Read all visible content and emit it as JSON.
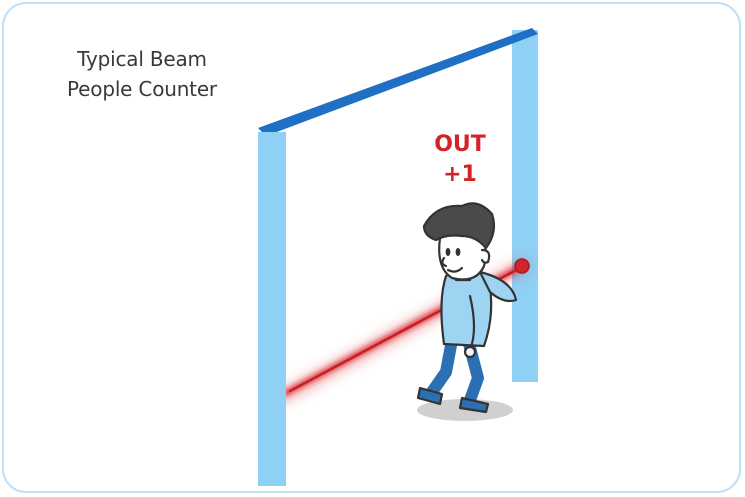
{
  "title": {
    "line1": "Typical Beam",
    "line2": "People Counter"
  },
  "counter": {
    "direction": "OUT",
    "increment": "+1"
  },
  "colors": {
    "frame_border": "#bfe0f7",
    "post_light_blue": "#8fd0f5",
    "header_beam_blue": "#1f6fc4",
    "laser_red": "#d3232a",
    "label_red": "#d3232a",
    "person_shirt": "#9fd3f2",
    "person_pants": "#2c6fb3",
    "person_hair": "#4a4a4a",
    "shadow_gray": "#d0d0d0"
  },
  "icons": [
    "door-frame",
    "laser-beam",
    "sensor-emitter",
    "walking-person"
  ]
}
